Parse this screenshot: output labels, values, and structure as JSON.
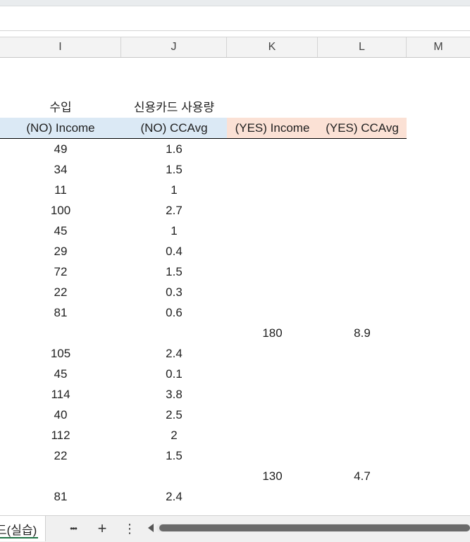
{
  "columns": [
    "I",
    "J",
    "K",
    "L",
    "M"
  ],
  "headers": {
    "korean_income": "수입",
    "korean_ccavg": "신용카드 사용량",
    "no_income": "(NO) Income",
    "no_ccavg": "(NO) CCAvg",
    "yes_income": "(YES) Income",
    "yes_ccavg": "(YES) CCAvg"
  },
  "rows": [
    {
      "ni": "49",
      "nc": "1.6",
      "yi": "",
      "yc": ""
    },
    {
      "ni": "34",
      "nc": "1.5",
      "yi": "",
      "yc": ""
    },
    {
      "ni": "11",
      "nc": "1",
      "yi": "",
      "yc": ""
    },
    {
      "ni": "100",
      "nc": "2.7",
      "yi": "",
      "yc": ""
    },
    {
      "ni": "45",
      "nc": "1",
      "yi": "",
      "yc": ""
    },
    {
      "ni": "29",
      "nc": "0.4",
      "yi": "",
      "yc": ""
    },
    {
      "ni": "72",
      "nc": "1.5",
      "yi": "",
      "yc": ""
    },
    {
      "ni": "22",
      "nc": "0.3",
      "yi": "",
      "yc": ""
    },
    {
      "ni": "81",
      "nc": "0.6",
      "yi": "",
      "yc": ""
    },
    {
      "ni": "",
      "nc": "",
      "yi": "180",
      "yc": "8.9"
    },
    {
      "ni": "105",
      "nc": "2.4",
      "yi": "",
      "yc": ""
    },
    {
      "ni": "45",
      "nc": "0.1",
      "yi": "",
      "yc": ""
    },
    {
      "ni": "114",
      "nc": "3.8",
      "yi": "",
      "yc": ""
    },
    {
      "ni": "40",
      "nc": "2.5",
      "yi": "",
      "yc": ""
    },
    {
      "ni": "112",
      "nc": "2",
      "yi": "",
      "yc": ""
    },
    {
      "ni": "22",
      "nc": "1.5",
      "yi": "",
      "yc": ""
    },
    {
      "ni": "",
      "nc": "",
      "yi": "130",
      "yc": "4.7"
    },
    {
      "ni": "81",
      "nc": "2.4",
      "yi": "",
      "yc": ""
    }
  ],
  "sheet_tab": {
    "label": "드(실습)"
  },
  "tabbar": {
    "more_label": "•••",
    "add_label": "+",
    "options_label": "⋮"
  },
  "colors": {
    "no_band": "#dbe9f5",
    "yes_band": "#fbe1d5",
    "sheet_underline": "#217346"
  },
  "icons": [
    "more-icon",
    "add-sheet-icon",
    "options-icon",
    "scroll-left-icon"
  ]
}
